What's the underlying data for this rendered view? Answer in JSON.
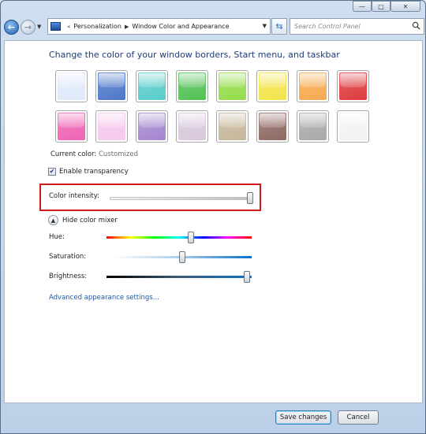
{
  "nav": {
    "address_crumbs": [
      "Personalization",
      "Window Color and Appearance"
    ],
    "search_placeholder": "Search Control Panel"
  },
  "heading": "Change the color of your window borders, Start menu, and taskbar",
  "swatches": [
    {
      "name": "sky",
      "color": "#dfe9fb"
    },
    {
      "name": "twilight",
      "color": "#4f78c9"
    },
    {
      "name": "sea",
      "color": "#58cdcb"
    },
    {
      "name": "leaf",
      "color": "#53c155"
    },
    {
      "name": "lime",
      "color": "#94dc4a"
    },
    {
      "name": "lemon",
      "color": "#f2e44c"
    },
    {
      "name": "pumpkin",
      "color": "#f6aa4f"
    },
    {
      "name": "ruby",
      "color": "#de3b3f"
    },
    {
      "name": "fuchsia",
      "color": "#ef63b4"
    },
    {
      "name": "blush",
      "color": "#f5c9ec"
    },
    {
      "name": "violet",
      "color": "#a587cf"
    },
    {
      "name": "lavender",
      "color": "#d8c8dc"
    },
    {
      "name": "taupe",
      "color": "#c6b79a"
    },
    {
      "name": "chocolate",
      "color": "#8f6a64"
    },
    {
      "name": "slate",
      "color": "#a9a9a9"
    },
    {
      "name": "frost",
      "color": "#f2f2f2"
    }
  ],
  "current_color": {
    "label": "Current color:",
    "value": "Customized"
  },
  "transparency": {
    "label": "Enable transparency",
    "checked": true
  },
  "intensity": {
    "label": "Color intensity:",
    "level": 0.98
  },
  "mixer_toggle": "Hide color mixer",
  "mixer": {
    "hue": {
      "label": "Hue:",
      "level": 0.58
    },
    "saturation": {
      "label": "Saturation:",
      "level": 0.5
    },
    "brightness": {
      "label": "Brightness:",
      "level": 0.97
    }
  },
  "advanced_link": "Advanced appearance settings...",
  "buttons": {
    "save": "Save changes",
    "cancel": "Cancel"
  },
  "colors": {
    "highlight_border": "#cc1b1b",
    "link": "#1d59a6",
    "heading": "#1e3a78"
  }
}
